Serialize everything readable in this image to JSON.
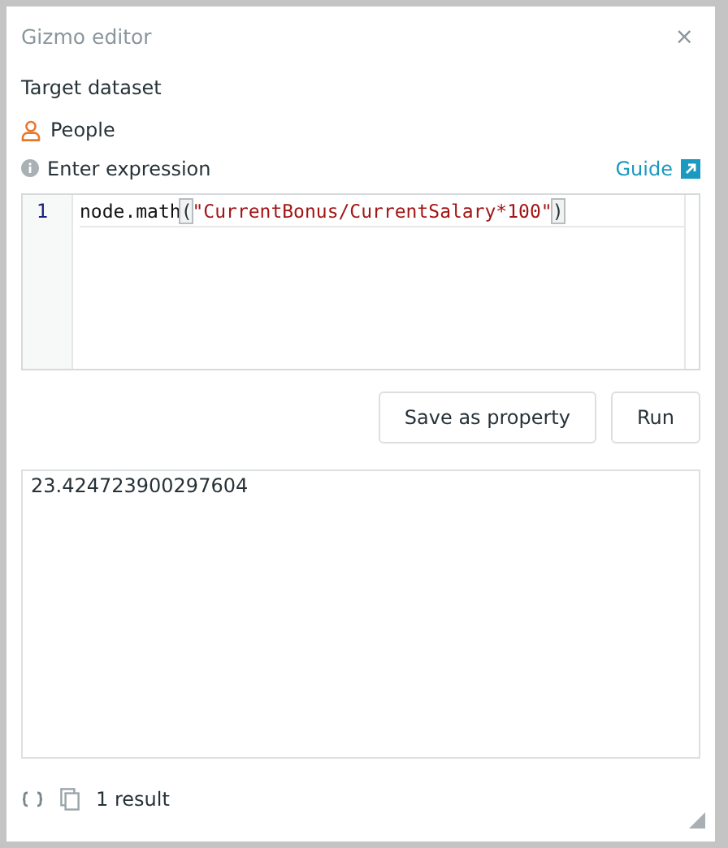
{
  "window": {
    "title": "Gizmo editor",
    "close": "×"
  },
  "target_label": "Target dataset",
  "dataset": "People",
  "expression_label": "Enter expression",
  "guide_link": "Guide",
  "editor": {
    "lines": [
      {
        "number": "1",
        "tokens": [
          {
            "kind": "plain",
            "text": "node.math"
          },
          {
            "kind": "bracket",
            "text": "("
          },
          {
            "kind": "string",
            "text": "\"CurrentBonus/CurrentSalary*100\""
          },
          {
            "kind": "bracket",
            "text": ")"
          }
        ]
      }
    ]
  },
  "buttons": [
    "Save as property",
    "Run"
  ],
  "result": "23.424723900297604",
  "status": {
    "count": "1 result"
  }
}
